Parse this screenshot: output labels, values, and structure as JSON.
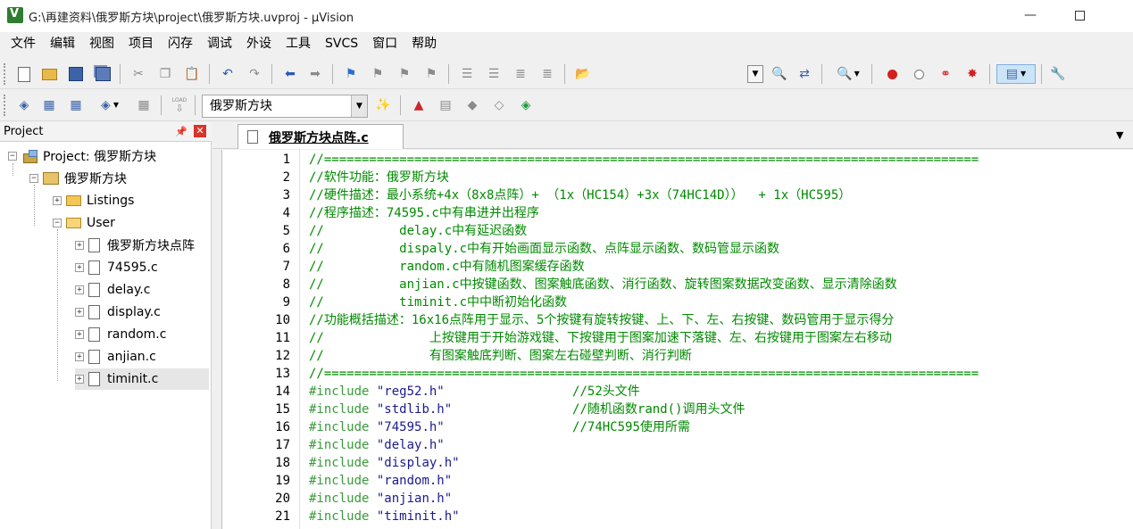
{
  "window": {
    "title": "G:\\再建资料\\俄罗斯方块\\project\\俄罗斯方块.uvproj - µVision",
    "minimize_glyph": "—"
  },
  "menu": [
    "文件",
    "编辑",
    "视图",
    "项目",
    "闪存",
    "调试",
    "外设",
    "工具",
    "SVCS",
    "窗口",
    "帮助"
  ],
  "toolbar2": {
    "target_name": "俄罗斯方块",
    "load_label": "LOAD"
  },
  "project_pane": {
    "title": "Project",
    "pin_glyph": "📌",
    "close_glyph": "✕",
    "root": "Project: 俄罗斯方块",
    "target": "俄罗斯方块",
    "groups": [
      {
        "name": "Listings",
        "files": []
      },
      {
        "name": "User",
        "files": [
          "俄罗斯方块点阵",
          "74595.c",
          "delay.c",
          "display.c",
          "random.c",
          "anjian.c",
          "timinit.c"
        ]
      }
    ]
  },
  "editor": {
    "tab_label": "俄罗斯方块点阵.c",
    "lines": [
      {
        "n": "1",
        "comment": "//======================================================================================="
      },
      {
        "n": "2",
        "comment": "//软件功能：俄罗斯方块"
      },
      {
        "n": "3",
        "comment": "//硬件描述：最小系统+4x（8x8点阵）+ （1x（HC154）+3x（74HC14D））  + 1x（HC595）"
      },
      {
        "n": "4",
        "comment": "//程序描述：74595.c中有串进并出程序"
      },
      {
        "n": "5",
        "comment": "//          delay.c中有延迟函数"
      },
      {
        "n": "6",
        "comment": "//          dispaly.c中有开始画面显示函数、点阵显示函数、数码管显示函数"
      },
      {
        "n": "7",
        "comment": "//          random.c中有随机图案缓存函数"
      },
      {
        "n": "8",
        "comment": "//          anjian.c中按键函数、图案触底函数、消行函数、旋转图案数据改变函数、显示清除函数"
      },
      {
        "n": "9",
        "comment": "//          timinit.c中中断初始化函数"
      },
      {
        "n": "10",
        "comment": "//功能概括描述：16x16点阵用于显示、5个按键有旋转按键、上、下、左、右按键、数码管用于显示得分"
      },
      {
        "n": "11",
        "comment": "//              上按键用于开始游戏键、下按键用于图案加速下落键、左、右按键用于图案左右移动"
      },
      {
        "n": "12",
        "comment": "//              有图案触底判断、图案左右碰壁判断、消行判断"
      },
      {
        "n": "13",
        "comment": "//======================================================================================="
      },
      {
        "n": "14",
        "directive": "#include",
        "file": "\"reg52.h\"",
        "trail": "//52头文件",
        "pad": "                 "
      },
      {
        "n": "15",
        "directive": "#include",
        "file": "\"stdlib.h\"",
        "trail": "//随机函数rand()调用头文件",
        "pad": "                "
      },
      {
        "n": "16",
        "directive": "#include",
        "file": "\"74595.h\"",
        "trail": "//74HC595使用所需",
        "pad": "                 "
      },
      {
        "n": "17",
        "directive": "#include",
        "file": "\"delay.h\""
      },
      {
        "n": "18",
        "directive": "#include",
        "file": "\"display.h\""
      },
      {
        "n": "19",
        "directive": "#include",
        "file": "\"random.h\""
      },
      {
        "n": "20",
        "directive": "#include",
        "file": "\"anjian.h\""
      },
      {
        "n": "21",
        "directive": "#include",
        "file": "\"timinit.h\""
      }
    ]
  },
  "colors": {
    "comment": "#008a00",
    "preprocessor": "#3a9a3a",
    "string": "#1a1a8f"
  }
}
